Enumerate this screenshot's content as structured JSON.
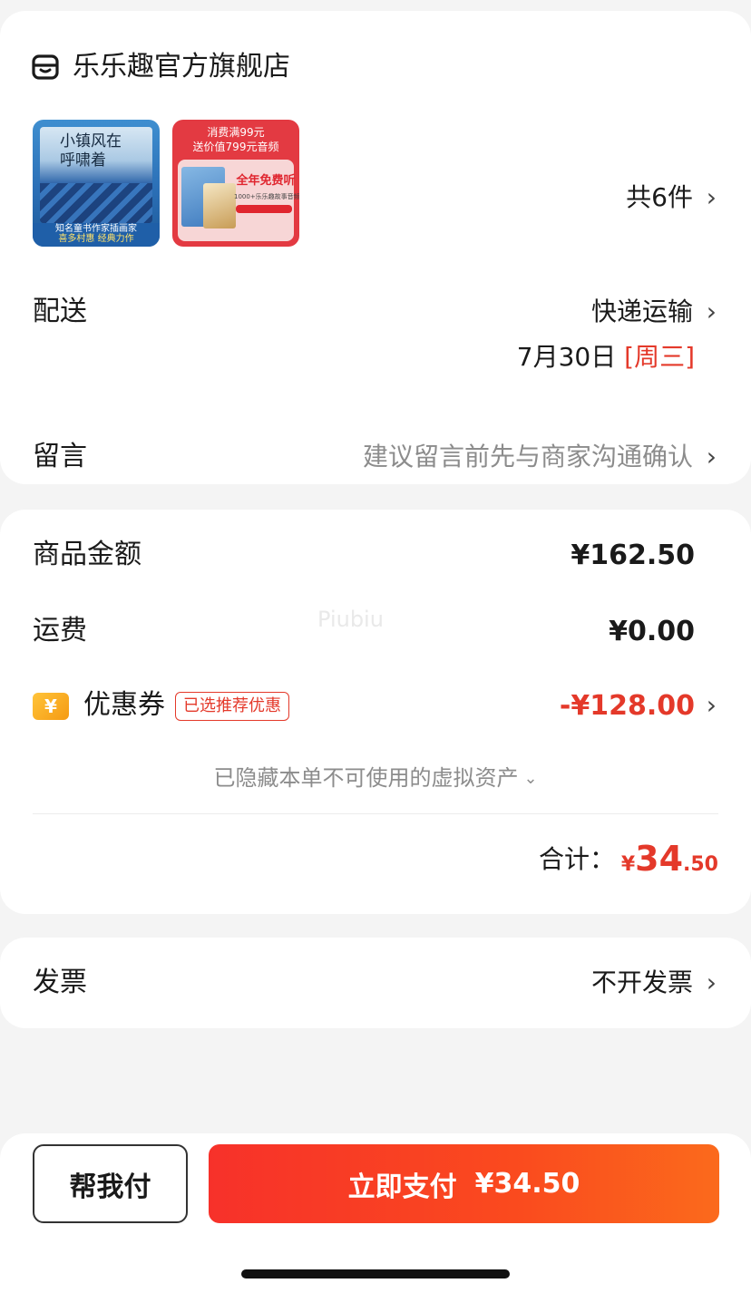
{
  "store": {
    "name": "乐乐趣官方旗舰店",
    "icon": "store-icon"
  },
  "products": {
    "thumb1": {
      "title": "小镇风在呼啸着",
      "caption_line1": "知名童书作家插画家",
      "caption_line2": "喜多村惠 经典力作"
    },
    "thumb2": {
      "top_line1": "消费满99元",
      "top_line2": "送价值799元音频",
      "free_text": "全年免费听",
      "sub_text": "1000+乐乐趣故事音频"
    },
    "count_label": "共6件"
  },
  "delivery": {
    "label": "配送",
    "method": "快递运输",
    "date": "7月30日",
    "weekday": "[周三]"
  },
  "message": {
    "label": "留言",
    "placeholder": "建议留言前先与商家沟通确认"
  },
  "summary": {
    "subtotal_label": "商品金额",
    "subtotal_value": "¥162.50",
    "shipping_label": "运费",
    "shipping_value": "¥0.00",
    "watermark": "Piubiu",
    "coupon_icon_glyph": "¥",
    "coupon_label": "优惠券",
    "coupon_badge": "已选推荐优惠",
    "coupon_value": "-¥128.00",
    "hidden_assets": "已隐藏本单不可使用的虚拟资产",
    "total_label": "合计：",
    "total_symbol": "¥",
    "total_integer": "34",
    "total_decimal": ".50"
  },
  "invoice": {
    "label": "发票",
    "value": "不开发票"
  },
  "actions": {
    "help_pay": "帮我付",
    "pay_now": "立即支付",
    "pay_amount": "¥34.50"
  },
  "colors": {
    "accent": "#e4392a",
    "pay_gradient_start": "#f7312a",
    "pay_gradient_end": "#fb6a1c",
    "coupon_icon": "#f5a623"
  }
}
